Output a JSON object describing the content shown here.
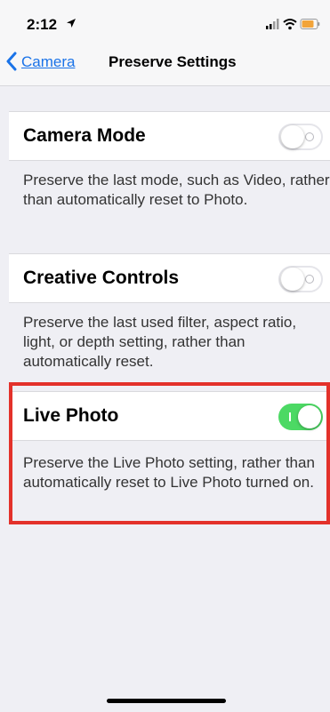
{
  "status_bar": {
    "time": "2:12",
    "icons": [
      "location-arrow-icon",
      "signal-icon",
      "wifi-icon",
      "battery-icon"
    ]
  },
  "nav": {
    "back_label": "Camera",
    "title": "Preserve Settings"
  },
  "settings": [
    {
      "label": "Camera Mode",
      "enabled": false,
      "description": "Preserve the last mode, such as Video, rather than automatically reset to Photo."
    },
    {
      "label": "Creative Controls",
      "enabled": false,
      "description": "Preserve the last used filter, aspect ratio, light, or depth setting, rather than automatically reset."
    },
    {
      "label": "Live Photo",
      "enabled": true,
      "description": "Preserve the Live Photo setting, rather than automatically reset to Live Photo turned on."
    }
  ],
  "colors": {
    "accent": "#1a73e8",
    "toggle_on": "#4cd964",
    "highlight": "#e3312a",
    "background": "#efeff4"
  }
}
